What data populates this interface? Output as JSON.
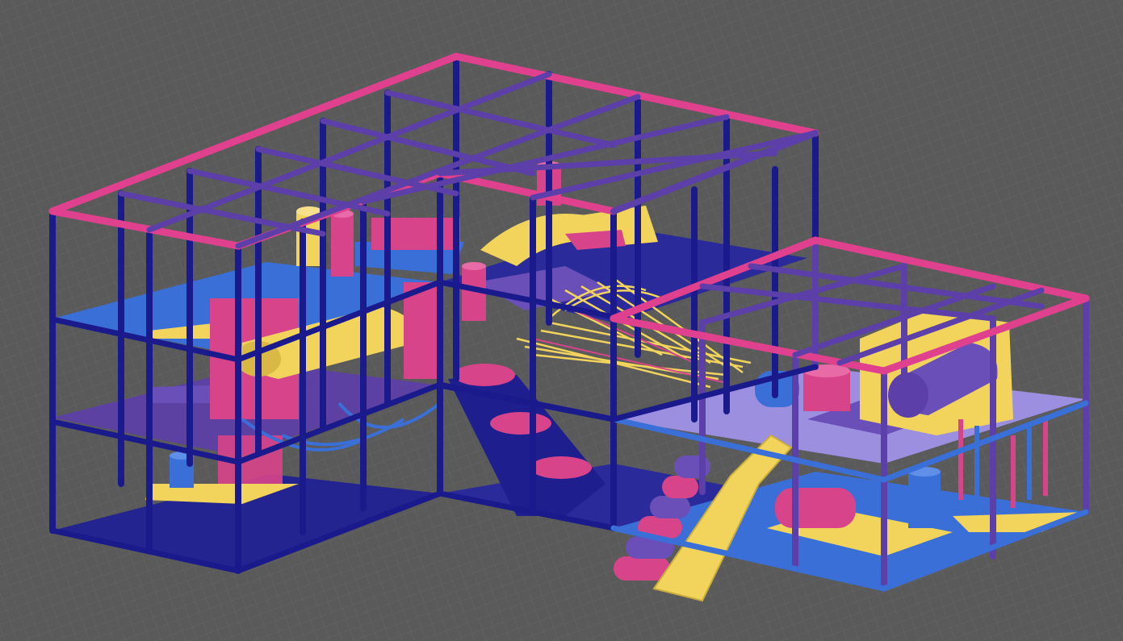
{
  "scene": {
    "subject": "indoor-playground-3d-model",
    "palette": {
      "background": "#5a5a5a",
      "grid_line": "#777777",
      "frame_navy": "#1a1a8c",
      "frame_violet": "#5c3fa8",
      "top_rail_pink": "#e0418f",
      "platform_blue": "#3a6fd8",
      "platform_purple": "#6a4fb8",
      "platform_lavender": "#9c8fe0",
      "accent_yellow": "#f2d45c",
      "accent_pink": "#d8448a",
      "floor_dark": "#242490"
    }
  }
}
